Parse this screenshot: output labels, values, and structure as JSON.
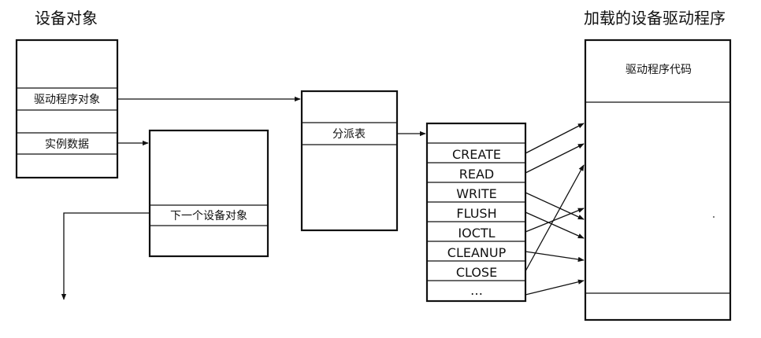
{
  "device_object": {
    "title": "设备对象",
    "driver_object_label": "驱动程序对象",
    "instance_data_label": "实例数据"
  },
  "next_device": {
    "label": "下一个设备对象"
  },
  "dispatch": {
    "label": "分派表"
  },
  "functions": [
    "CREATE",
    "READ",
    "WRITE",
    "FLUSH",
    "IOCTL",
    "CLEANUP",
    "CLOSE",
    "…"
  ],
  "loaded_driver": {
    "title": "加载的设备驱动程序",
    "code_label": "驱动程序代码"
  }
}
